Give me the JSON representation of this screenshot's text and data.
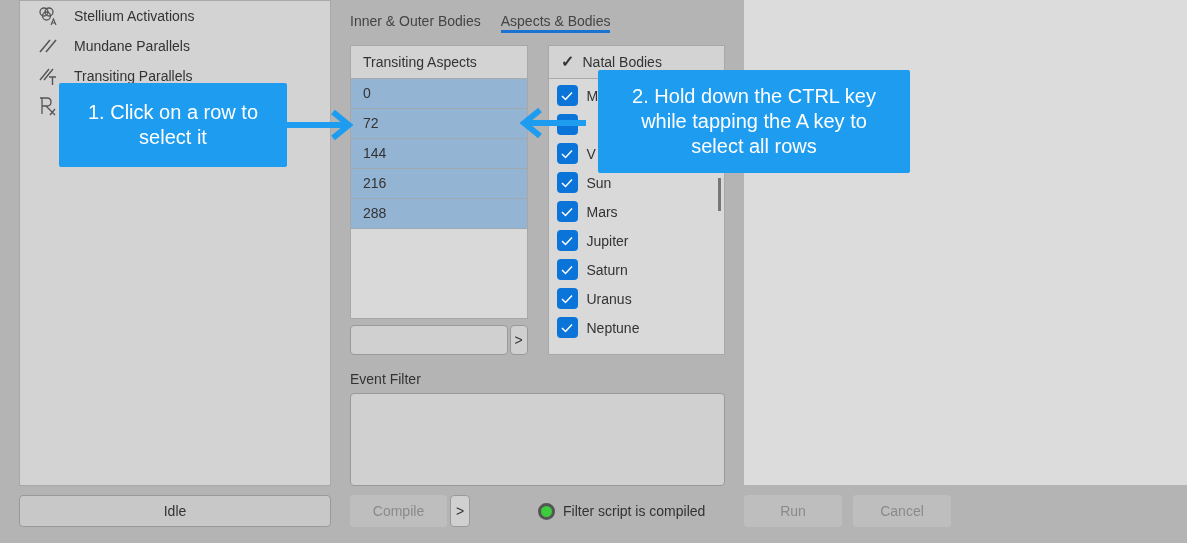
{
  "sidebar": {
    "items": [
      {
        "kind": "stellium",
        "label": "Stellium Activations"
      },
      {
        "kind": "mundane",
        "label": "Mundane Parallels"
      },
      {
        "kind": "transiting",
        "label": "Transiting Parallels"
      },
      {
        "kind": "rx"
      }
    ]
  },
  "status_button": "Idle",
  "tabs": [
    {
      "label": "Inner & Outer Bodies",
      "selected": false
    },
    {
      "label": "Aspects & Bodies",
      "selected": true
    }
  ],
  "transiting_aspects": {
    "header": "Transiting Aspects",
    "rows": [
      {
        "label": "0",
        "selected": true
      },
      {
        "label": "72",
        "selected": true
      },
      {
        "label": "144",
        "selected": true
      },
      {
        "label": "216",
        "selected": true
      },
      {
        "label": "288",
        "selected": true
      }
    ],
    "scroll_button": ">"
  },
  "natal_bodies": {
    "header_check": "✓",
    "header": "Natal Bodies",
    "items": [
      {
        "label": "M",
        "checked": true
      },
      {
        "checked": true
      },
      {
        "label": "V",
        "checked": true
      },
      {
        "label": "Sun",
        "checked": true
      },
      {
        "label": "Mars",
        "checked": true
      },
      {
        "label": "Jupiter",
        "checked": true
      },
      {
        "label": "Saturn",
        "checked": true
      },
      {
        "label": "Uranus",
        "checked": true
      },
      {
        "label": "Neptune",
        "checked": true
      }
    ]
  },
  "event_filter": {
    "label": "Event Filter"
  },
  "compile": {
    "label": "Compile",
    "disabled": true,
    "more": ">"
  },
  "filter_status": {
    "text": "Filter script is compiled",
    "on": true
  },
  "actions": [
    {
      "label": "Run",
      "disabled": true
    },
    {
      "label": "Cancel",
      "disabled": true
    }
  ],
  "callouts": [
    {
      "text": "1. Click on a row to select it",
      "kind": "right"
    },
    {
      "text": "2. Hold down the CTRL key while tapping the A key to select all rows",
      "kind": "left"
    }
  ]
}
